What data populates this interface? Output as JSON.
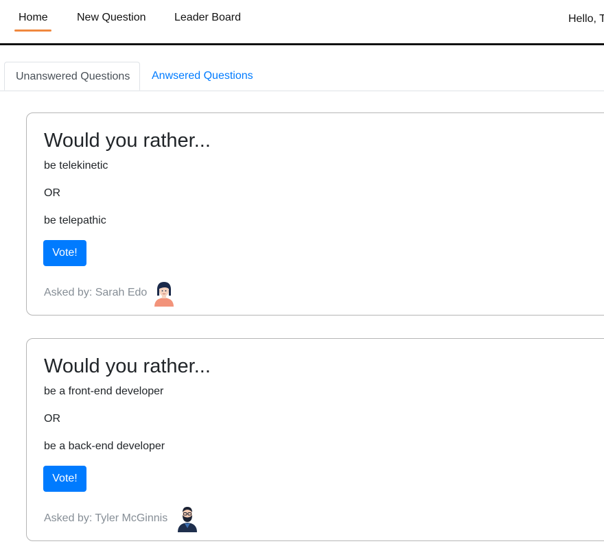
{
  "nav": {
    "home": "Home",
    "new_question": "New Question",
    "leader_board": "Leader Board",
    "greeting": "Hello, T",
    "active_color": "#f0883e"
  },
  "tabs": {
    "unanswered": "Unanswered Questions",
    "answered": "Anwsered Questions",
    "active": "unanswered"
  },
  "questions": [
    {
      "title": "Would you rather...",
      "option_one": "be telekinetic",
      "or_label": "OR",
      "option_two": "be telepathic",
      "vote_label": "Vote!",
      "asked_by": "Asked by: Sarah Edo",
      "avatar_icon": "woman-avatar-icon"
    },
    {
      "title": "Would you rather...",
      "option_one": "be a front-end developer",
      "or_label": "OR",
      "option_two": "be a back-end developer",
      "vote_label": "Vote!",
      "asked_by": "Asked by: Tyler McGinnis",
      "avatar_icon": "bearded-man-avatar-icon"
    }
  ],
  "colors": {
    "primary": "#007bff",
    "muted": "#868e96",
    "accent": "#f0883e"
  }
}
